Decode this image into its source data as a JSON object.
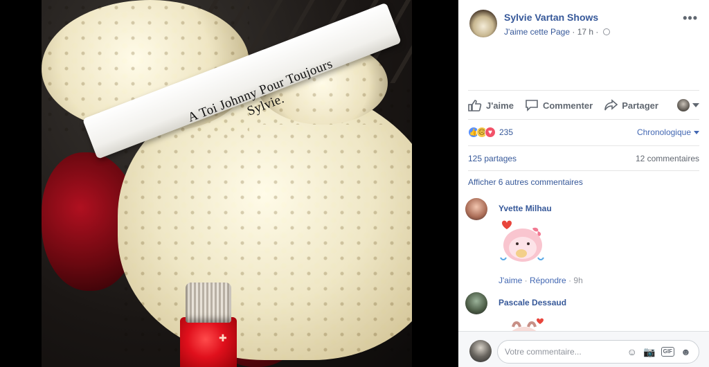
{
  "photo": {
    "ribbon_line1": "A Toi Johnny Pour Toujours",
    "ribbon_line2": "Sylvie."
  },
  "post": {
    "page_name": "Sylvie Vartan Shows",
    "like_page": "J'aime cette Page",
    "separator": "·",
    "time": "17 h",
    "privacy_icon": "globe-icon",
    "more_icon": "•••"
  },
  "actions": {
    "like": "J'aime",
    "comment": "Commenter",
    "share": "Partager"
  },
  "reactions": {
    "types": [
      "like",
      "sad",
      "love"
    ],
    "count": "235",
    "sort": "Chronologique"
  },
  "stats": {
    "shares": "125 partages",
    "comments": "12 commentaires"
  },
  "more_comments": "Afficher 6 autres commentaires",
  "comments": [
    {
      "author": "Yvette Milhau",
      "like": "J'aime",
      "reply": "Répondre",
      "time": "9h"
    },
    {
      "author": "Pascale Dessaud"
    }
  ],
  "composer": {
    "placeholder": "Votre commentaire..."
  },
  "colors": {
    "link": "#365899",
    "accent": "#4267b2",
    "muted": "#616770"
  }
}
